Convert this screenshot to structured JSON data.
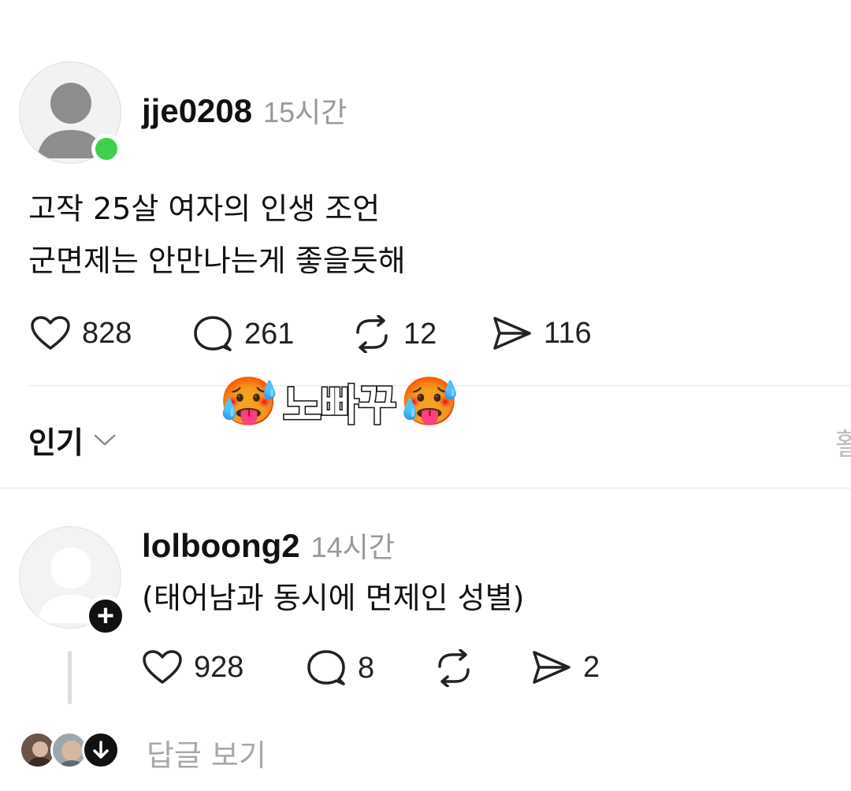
{
  "post": {
    "username": "jje0208",
    "time": "15시간",
    "line1": "고작 25살 여자의 인생 조언",
    "line2": "군면제는 안만나는게 좋을듯해",
    "likes": "828",
    "comments": "261",
    "reposts": "12",
    "shares": "116"
  },
  "sticker": {
    "text": "노빠꾸",
    "emoji": "🥵"
  },
  "sort": {
    "label": "인기"
  },
  "edge_text": "활",
  "reply": {
    "username": "lolboong2",
    "time": "14시간",
    "text": "(태어남과 동시에 면제인 성별)",
    "likes": "928",
    "comments": "8",
    "shares": "2",
    "follow": "+"
  },
  "view_replies": {
    "label": "답글 보기"
  },
  "colors": {
    "online": "#3fd04b",
    "muted": "#9a9a9a",
    "text": "#111111"
  },
  "icons": [
    "heart-icon",
    "comment-icon",
    "repost-icon",
    "share-icon",
    "chevron-down-icon",
    "arrow-down-icon",
    "person-icon"
  ]
}
